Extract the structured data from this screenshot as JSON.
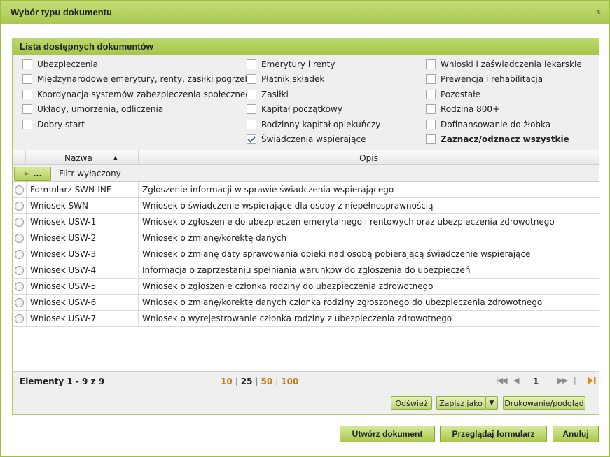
{
  "dialog": {
    "title": "Wybór typu dokumentu",
    "close_glyph": "x"
  },
  "panel": {
    "title": "Lista dostępnych dokumentów"
  },
  "checkboxes": {
    "col1": [
      {
        "label": "Ubezpieczenia",
        "checked": false
      },
      {
        "label": "Międzynarodowe emerytury, renty, zasiłki pogrzeb.",
        "checked": false
      },
      {
        "label": "Koordynacja systemów zabezpieczenia społecznego",
        "checked": false
      },
      {
        "label": "Układy, umorzenia, odliczenia",
        "checked": false
      },
      {
        "label": "Dobry start",
        "checked": false
      }
    ],
    "col2": [
      {
        "label": "Emerytury i renty",
        "checked": false
      },
      {
        "label": "Płatnik składek",
        "checked": false
      },
      {
        "label": "Zasiłki",
        "checked": false
      },
      {
        "label": "Kapitał początkowy",
        "checked": false
      },
      {
        "label": "Rodzinny kapitał opiekuńczy",
        "checked": false
      },
      {
        "label": "Świadczenia wspierające",
        "checked": true
      }
    ],
    "col3": [
      {
        "label": "Wnioski i zaświadczenia lekarskie",
        "checked": false
      },
      {
        "label": "Prewencja i rehabilitacja",
        "checked": false
      },
      {
        "label": "Pozostałe",
        "checked": false
      },
      {
        "label": "Rodzina 800+",
        "checked": false
      },
      {
        "label": "Dofinansowanie do żłobka",
        "checked": false
      },
      {
        "label": "Zaznacz/odznacz wszystkie",
        "checked": false
      }
    ]
  },
  "table": {
    "columns": {
      "name": "Nazwa",
      "desc": "Opis"
    },
    "filter": {
      "button_label": "...",
      "status": "Filtr wyłączony"
    },
    "rows": [
      {
        "name": "Formularz SWN-INF",
        "desc": "Zgłoszenie informacji w sprawie świadczenia wspierającego"
      },
      {
        "name": "Wniosek SWN",
        "desc": "Wniosek o świadczenie wspierające dla osoby z niepełnosprawnością"
      },
      {
        "name": "Wniosek USW-1",
        "desc": "Wniosek o zgłoszenie do ubezpieczeń emerytalnego i rentowych oraz ubezpieczenia zdrowotnego"
      },
      {
        "name": "Wniosek USW-2",
        "desc": "Wniosek o zmianę/korektę danych"
      },
      {
        "name": "Wniosek USW-3",
        "desc": "Wniosek o zmianę daty sprawowania opieki nad osobą pobierającą świadczenie wspierające"
      },
      {
        "name": "Wniosek USW-4",
        "desc": "Informacja o zaprzestaniu spełniania warunków do zgłoszenia do ubezpieczeń"
      },
      {
        "name": "Wniosek USW-5",
        "desc": "Wniosek o zgłoszenie członka rodziny do ubezpieczenia zdrowotnego"
      },
      {
        "name": "Wniosek USW-6",
        "desc": "Wniosek o zmianę/korektę danych członka rodziny zgłoszonego do ubezpieczenia zdrowotnego"
      },
      {
        "name": "Wniosek USW-7",
        "desc": "Wniosek o wyrejestrowanie członka rodziny z ubezpieczenia zdrowotnego"
      }
    ]
  },
  "pager": {
    "count": "Elementy 1 - 9 z 9",
    "sizes": [
      "10",
      "25",
      "50",
      "100"
    ],
    "active_size": "25",
    "page": "1"
  },
  "toolbar": {
    "refresh": "Odśwież",
    "save_as": "Zapisz jako",
    "print": "Drukowanie/podgląd"
  },
  "footer": {
    "create": "Utwórz dokument",
    "browse": "Przeglądaj formularz",
    "cancel": "Anuluj"
  },
  "colors": {
    "accent_green": "#a9c94e",
    "link_orange": "#c97a16"
  }
}
